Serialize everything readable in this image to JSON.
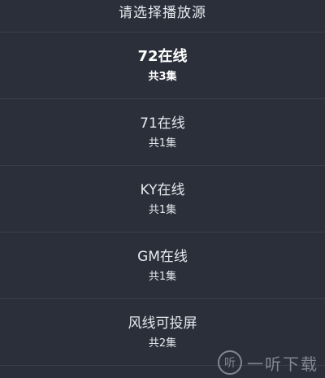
{
  "header": {
    "title": "请选择播放源"
  },
  "sources": [
    {
      "name": "72在线",
      "count": "共3集"
    },
    {
      "name": "71在线",
      "count": "共1集"
    },
    {
      "name": "KY在线",
      "count": "共1集"
    },
    {
      "name": "GM在线",
      "count": "共1集"
    },
    {
      "name": "风线可投屏",
      "count": "共2集"
    }
  ],
  "watermark": {
    "icon_glyph": "听",
    "text": "一听下载"
  }
}
